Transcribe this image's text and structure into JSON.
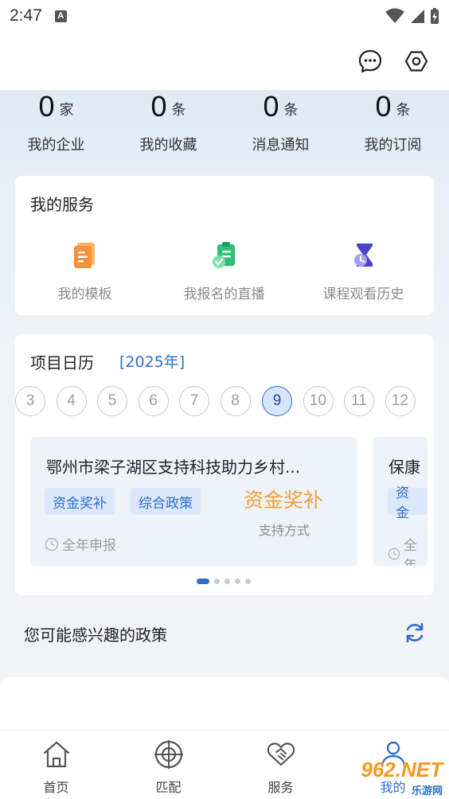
{
  "status_bar": {
    "time": "2:47",
    "notification_icon": "A"
  },
  "stats": [
    {
      "num": "0",
      "unit": "家",
      "label": "我的企业"
    },
    {
      "num": "0",
      "unit": "条",
      "label": "我的收藏"
    },
    {
      "num": "0",
      "unit": "条",
      "label": "消息通知"
    },
    {
      "num": "0",
      "unit": "条",
      "label": "我的订阅"
    }
  ],
  "services": {
    "title": "我的服务",
    "items": [
      {
        "label": "我的模板",
        "icon": "template-icon",
        "color": "#f59a3c"
      },
      {
        "label": "我报名的直播",
        "icon": "clipboard-check-icon",
        "color": "#2fbf77"
      },
      {
        "label": "课程观看历史",
        "icon": "hourglass-icon",
        "color": "#5b54d6"
      }
    ]
  },
  "calendar": {
    "title": "项目日历",
    "year": "[2025年]",
    "months": [
      "3",
      "4",
      "5",
      "6",
      "7",
      "8",
      "9",
      "10",
      "11",
      "12"
    ],
    "active_month": "9",
    "projects": [
      {
        "title": "鄂州市梁子湖区支持科技助力乡村...",
        "tags": [
          "资金奖补",
          "综合政策"
        ],
        "amount": "资金奖补",
        "amount_sub": "支持方式",
        "deadline": "全年申报"
      },
      {
        "title": "保康",
        "tags": [
          "资金"
        ],
        "deadline": "全年"
      }
    ]
  },
  "recommend": {
    "title": "您可能感兴趣的政策"
  },
  "bottom_nav": [
    {
      "label": "首页",
      "icon": "home-icon"
    },
    {
      "label": "匹配",
      "icon": "target-icon"
    },
    {
      "label": "服务",
      "icon": "handshake-icon"
    },
    {
      "label": "我的",
      "icon": "user-icon"
    }
  ],
  "watermark": {
    "big": "962.NET",
    "small": "乐游网"
  },
  "colors": {
    "accent": "#2f6dcc",
    "amount": "#f0a13a"
  }
}
